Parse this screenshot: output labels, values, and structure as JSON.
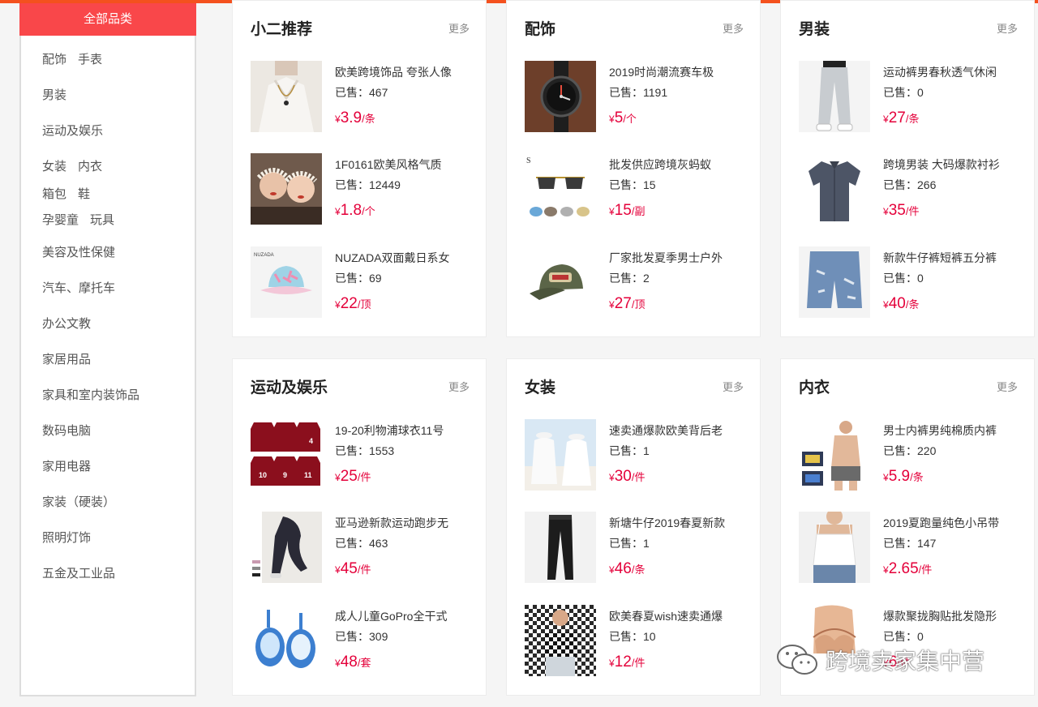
{
  "sidebar": {
    "title": "全部品类",
    "categories": [
      [
        "配饰",
        "手表"
      ],
      [
        "男装"
      ],
      [
        "运动及娱乐"
      ],
      [
        "女装",
        "内衣"
      ],
      [
        "箱包",
        "鞋"
      ],
      [
        "孕婴童",
        "玩具"
      ],
      [
        "美容及性保健"
      ],
      [
        "汽车、摩托车"
      ],
      [
        "办公文教"
      ],
      [
        "家居用品"
      ],
      [
        "家具和室内装饰品"
      ],
      [
        "数码电脑"
      ],
      [
        "家用电器"
      ],
      [
        "家装（硬装）"
      ],
      [
        "照明灯饰"
      ],
      [
        "五金及工业品"
      ]
    ]
  },
  "sold_label": "已售：",
  "currency": "¥",
  "more_label": "更多",
  "panels": [
    {
      "title": "小二推荐",
      "items": [
        {
          "name": "欧美跨境饰品 夸张人像",
          "sold": "467",
          "price": "3.9",
          "unit": "/条",
          "image": "necklace-photo"
        },
        {
          "name": "1F0161欧美风格气质",
          "sold": "12449",
          "price": "1.8",
          "unit": "/个",
          "image": "headband-photo"
        },
        {
          "name": "NUZADA双面戴日系女",
          "sold": "69",
          "price": "22",
          "unit": "/顶",
          "image": "bucket-hat-photo"
        }
      ]
    },
    {
      "title": "配饰",
      "items": [
        {
          "name": "2019时尚潮流赛车极",
          "sold": "1191",
          "price": "5",
          "unit": "/个",
          "image": "watch-photo"
        },
        {
          "name": "批发供应跨境灰蚂蚁",
          "sold": "15",
          "price": "15",
          "unit": "/副",
          "image": "sunglasses-photo"
        },
        {
          "name": "厂家批发夏季男士户外",
          "sold": "2",
          "price": "27",
          "unit": "/顶",
          "image": "cap-photo"
        }
      ]
    },
    {
      "title": "男装",
      "items": [
        {
          "name": "运动裤男春秋透气休闲",
          "sold": "0",
          "price": "27",
          "unit": "/条",
          "image": "pants-photo"
        },
        {
          "name": "跨境男装 大码爆款衬衫",
          "sold": "266",
          "price": "35",
          "unit": "/件",
          "image": "shirt-photo"
        },
        {
          "name": "新款牛仔裤短裤五分裤",
          "sold": "0",
          "price": "40",
          "unit": "/条",
          "image": "jeans-shorts-photo"
        }
      ]
    },
    {
      "title": "运动及娱乐",
      "items": [
        {
          "name": "19-20利物浦球衣11号",
          "sold": "1553",
          "price": "25",
          "unit": "/件",
          "image": "jerseys-photo"
        },
        {
          "name": "亚马逊新款运动跑步无",
          "sold": "463",
          "price": "45",
          "unit": "/件",
          "image": "leggings-photo"
        },
        {
          "name": "成人儿童GoPro全干式",
          "sold": "309",
          "price": "48",
          "unit": "/套",
          "image": "snorkel-mask-photo"
        }
      ]
    },
    {
      "title": "女装",
      "items": [
        {
          "name": "速卖通爆款欧美背后老",
          "sold": "1",
          "price": "30",
          "unit": "/件",
          "image": "beach-cover-photo"
        },
        {
          "name": "新塘牛仔2019春夏新款",
          "sold": "1",
          "price": "46",
          "unit": "/条",
          "image": "black-jeans-photo"
        },
        {
          "name": "欧美春夏wish速卖通爆",
          "sold": "10",
          "price": "12",
          "unit": "/件",
          "image": "checker-top-photo"
        }
      ]
    },
    {
      "title": "内衣",
      "items": [
        {
          "name": "男士内裤男纯棉质内裤",
          "sold": "220",
          "price": "5.9",
          "unit": "/条",
          "image": "underwear-photo"
        },
        {
          "name": "2019夏跑量纯色小吊带",
          "sold": "147",
          "price": "2.65",
          "unit": "/件",
          "image": "camisole-photo"
        },
        {
          "name": "爆款聚拢胸贴批发隐形",
          "sold": "0",
          "price": "6",
          "unit": "/件",
          "image": "bra-photo"
        }
      ]
    }
  ],
  "watermark": "跨境卖家集中营",
  "colors": {
    "accent": "#f9474a",
    "price": "#e4003a",
    "topbar": "#f4511e"
  }
}
